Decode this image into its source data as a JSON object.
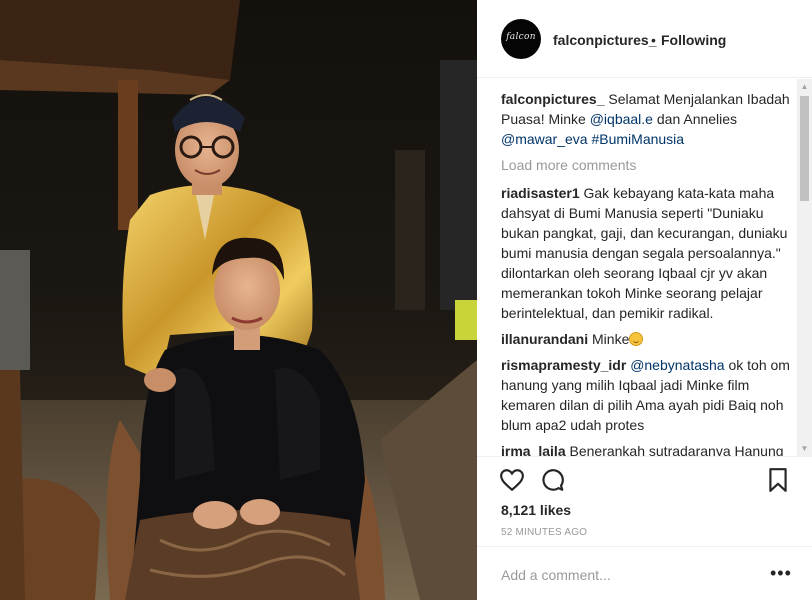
{
  "post": {
    "photo_alt": "Two people in traditional clothes posing at night",
    "username": "falconpictures_",
    "avatar_text": "falcon",
    "separator": "•",
    "follow_status": "Following",
    "colors": {
      "link": "#003569",
      "muted": "#999999",
      "text": "#262626"
    }
  },
  "caption": {
    "user": "falconpictures_",
    "text": " Selamat Menjalankan Ibadah Puasa! Minke ",
    "mention1": "@iqbaal.e",
    "text2": " dan Annelies ",
    "mention2": "@mawar_eva",
    "text3": " ",
    "hashtag": "#BumiManusia"
  },
  "load_more": "Load more comments",
  "comments": [
    {
      "user": "riadisaster1",
      "text": " Gak kebayang kata-kata maha dahsyat di Bumi Manusia seperti \"Duniaku bukan pangkat, gaji, dan kecurangan, duniaku bumi manusia dengan segala persoalannya.\" dilontarkan oleh seorang Iqbaal cjr yv akan memerankan tokoh Minke seorang pelajar berintelektual, dan pemikir radikal."
    },
    {
      "user": "illanurandani",
      "text": " Minke",
      "emoji": "grinning-face-icon"
    },
    {
      "user": "rismapramesty_idr",
      "mention": "@nebynatasha",
      "text": " ok toh om hanung yang milih Iqbaal jadi Minke film kemaren dilan di pilih Ama ayah pidi Baiq noh blum apa2 udah protes"
    },
    {
      "user": "irma_laila",
      "text": " Benerankah sutradaranya Hanung ?"
    }
  ],
  "actions": {
    "likes": "8,121 likes",
    "time": "52 MINUTES AGO"
  },
  "add_comment": {
    "placeholder": "Add a comment...",
    "more": "•••"
  }
}
